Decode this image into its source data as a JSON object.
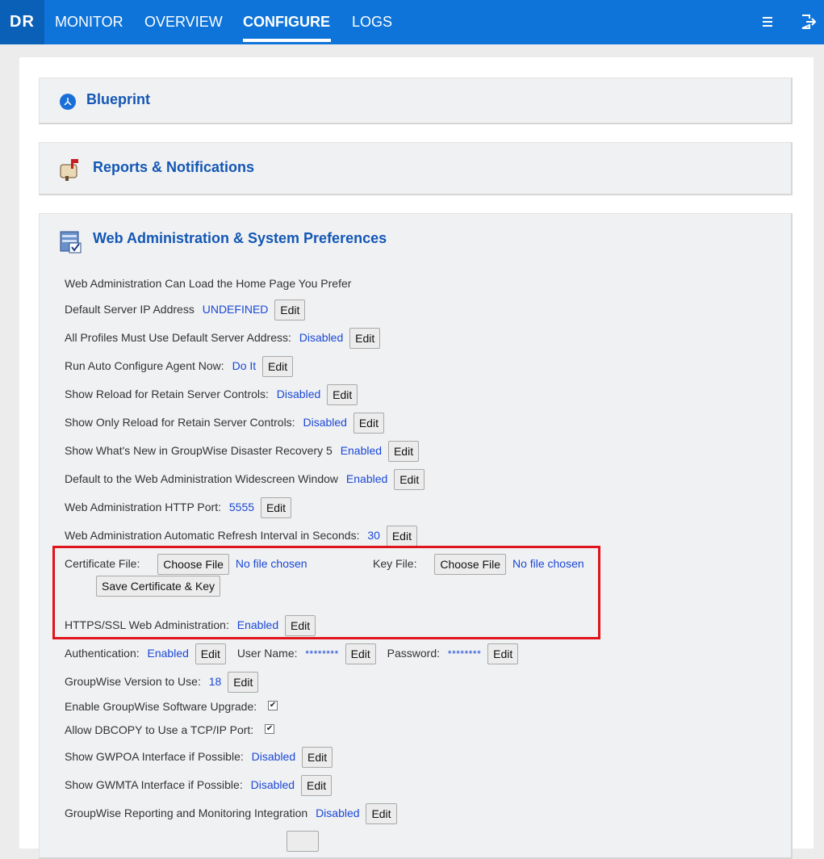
{
  "topbar": {
    "logo": "DR",
    "tabs": [
      {
        "label": "MONITOR"
      },
      {
        "label": "OVERVIEW"
      },
      {
        "label": "CONFIGURE"
      },
      {
        "label": "LOGS"
      }
    ],
    "active_tab": "CONFIGURE",
    "icons": [
      "menu-icon",
      "logout-icon"
    ],
    "color": "#0e74d9"
  },
  "sections": {
    "blueprint": {
      "title": "Blueprint",
      "icon": "blueprint-icon"
    },
    "reports": {
      "title": "Reports & Notifications",
      "icon": "mailbox-icon"
    },
    "webadmin": {
      "title": "Web Administration & System Preferences",
      "icon": "server-check-icon"
    }
  },
  "settings": {
    "intro": "Web Administration Can Load the Home Page You Prefer",
    "edit_label": "Edit",
    "default_ip": {
      "label": "Default Server IP Address",
      "value": "UNDEFINED"
    },
    "profiles_default": {
      "label": "All Profiles Must Use Default Server Address:",
      "value": "Disabled"
    },
    "auto_config": {
      "label": "Run Auto Configure Agent Now:",
      "value": "Do It"
    },
    "show_reload": {
      "label": "Show Reload for Retain Server Controls:",
      "value": "Disabled"
    },
    "show_only_reload": {
      "label": "Show Only Reload for Retain Server Controls:",
      "value": "Disabled"
    },
    "whats_new": {
      "label": "Show What's New in GroupWise Disaster Recovery 5",
      "value": "Enabled"
    },
    "widescreen": {
      "label": "Default to the Web Administration Widescreen Window",
      "value": "Enabled"
    },
    "http_port": {
      "label": "Web Administration HTTP Port:",
      "value": "5555"
    },
    "refresh": {
      "label": "Web Administration Automatic Refresh Interval in Seconds:",
      "value": "30"
    },
    "certificate": {
      "cert_label": "Certificate File:",
      "key_label": "Key File:",
      "choose_label": "Choose File",
      "no_file": "No file chosen",
      "save_label": "Save Certificate & Key"
    },
    "https": {
      "label": "HTTPS/SSL Web Administration:",
      "value": "Enabled"
    },
    "auth": {
      "label": "Authentication:",
      "value": "Enabled",
      "user_label": "User Name:",
      "user_value": "********",
      "pass_label": "Password:",
      "pass_value": "********"
    },
    "gw_version": {
      "label": "GroupWise Version to Use:",
      "value": "18"
    },
    "gw_upgrade": {
      "label": "Enable GroupWise Software Upgrade:",
      "checked": true
    },
    "dbcopy": {
      "label": "Allow DBCOPY to Use a TCP/IP Port:",
      "checked": true
    },
    "gwpoa": {
      "label": "Show GWPOA Interface if Possible:",
      "value": "Disabled"
    },
    "gwmta": {
      "label": "Show GWMTA Interface if Possible:",
      "value": "Disabled"
    },
    "reporting": {
      "label": "GroupWise Reporting and Monitoring Integration",
      "value": "Disabled"
    }
  },
  "colors": {
    "link": "#1a48d6",
    "title": "#1357b5",
    "highlight": "#e0141b"
  }
}
